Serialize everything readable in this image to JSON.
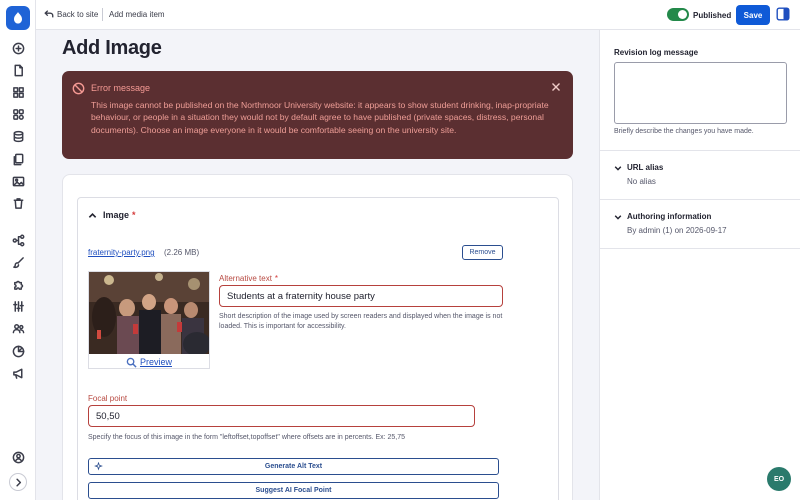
{
  "topbar": {
    "back_label": "Back to site",
    "breadcrumb": "Add media item",
    "published_label": "Published",
    "published_on": true,
    "save_label": "Save"
  },
  "page": {
    "title": "Add Image"
  },
  "error": {
    "title": "Error message",
    "body": "This image cannot be published on the Northmoor University website: it appears to show student drinking, inap-propriate behaviour, or people in a situation they would not by default agree to have published (private spaces, distress, personal documents). Choose an image everyone in it would be comfortable seeing on the university site."
  },
  "image_field": {
    "label": "Image",
    "required_mark": "*",
    "file_name": "fraternity-party.png",
    "file_size": "(2.26 MB)",
    "remove_label": "Remove",
    "preview_label": "Preview",
    "alt_label": "Alternative text",
    "alt_required_mark": "*",
    "alt_value": "Students at a fraternity house party",
    "alt_description": "Short description of the image used by screen readers and displayed when the image is not loaded. This is important for accessibility.",
    "focal_label": "Focal point",
    "focal_value": "50,50",
    "focal_description": "Specify the focus of this image in the form \"leftoffset,topoffset\" where offsets are in percents. Ex: 25,75",
    "generate_alt_label": "Generate Alt Text",
    "suggest_focal_label": "Suggest AI Focal Point"
  },
  "sidebar": {
    "revision_label": "Revision log message",
    "revision_value": "",
    "revision_description": "Briefly describe the changes you have made.",
    "url_alias_label": "URL alias",
    "url_alias_value": "No alias",
    "authoring_label": "Authoring information",
    "authoring_value": "By admin (1) on 2026-09-17"
  },
  "icons": {
    "logo": "drupal-logo-icon",
    "nav": [
      "plus-circle-icon",
      "document-icon",
      "grid-icon",
      "blocks-icon",
      "database-icon",
      "files-icon",
      "image-icon",
      "trash-icon",
      "workflow-icon",
      "brush-icon",
      "puzzle-icon",
      "sliders-icon",
      "users-icon",
      "reports-icon",
      "megaphone-icon",
      "user-circle-icon",
      "chevron-right-icon"
    ]
  },
  "help_fab_label": "EO",
  "colors": {
    "primary": "#0f5ad7",
    "published_toggle": "#23894a",
    "error_bg": "#5b2f31",
    "error_text": "#ef9e97",
    "invalid_border": "#b6413d"
  }
}
